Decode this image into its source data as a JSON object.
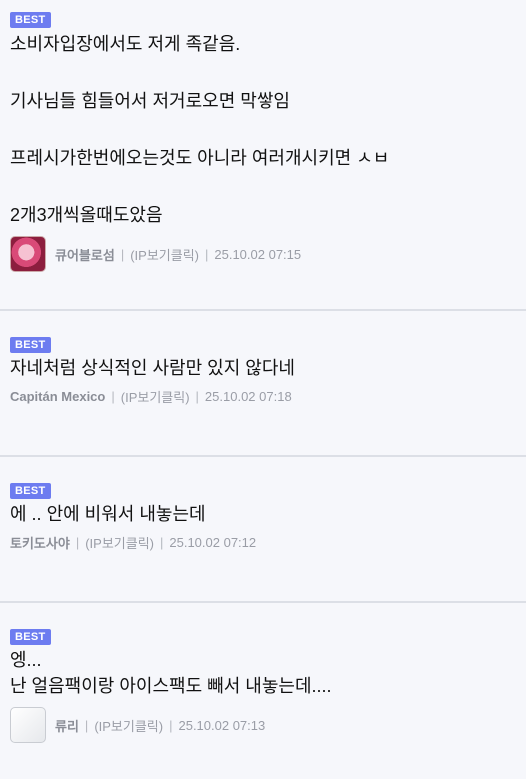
{
  "badge_label": "BEST",
  "ip_label": "(IP보기클릭)",
  "separator": "|",
  "comments": [
    {
      "lines": [
        "소비자입장에서도 저게 족같음.",
        "",
        "기사님들 힘들어서 저거로오면 막쌓임",
        "",
        "프레시가한번에오는것도 아니라 여러개시키면 ㅅㅂ",
        "",
        "2개3개씩올때도았음"
      ],
      "author": "큐어블로섬",
      "timestamp": "25.10.02 07:15"
    },
    {
      "lines": [
        "자네처럼 상식적인 사람만 있지 않다네"
      ],
      "author": "Capitán Mexico",
      "timestamp": "25.10.02 07:18"
    },
    {
      "lines": [
        "에 .. 안에 비워서 내놓는데"
      ],
      "author": "토키도사야",
      "timestamp": "25.10.02 07:12"
    },
    {
      "lines": [
        "엥...",
        "난 얼음팩이랑 아이스팩도 빼서 내놓는데...."
      ],
      "author": "류리",
      "timestamp": "25.10.02 07:13"
    }
  ]
}
